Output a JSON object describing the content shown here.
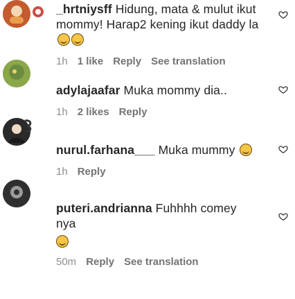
{
  "comments": [
    {
      "username": "_hrtniysff",
      "text": "Hidung, mata & mulut ikut mommy! Harap2 kening ikut daddy la",
      "emoji_count": 2,
      "time": "1h",
      "likes": "1 like",
      "reply": "Reply",
      "translate": "See translation"
    },
    {
      "username": "adylajaafar",
      "text": "Muka mommy dia..",
      "emoji_count": 0,
      "time": "1h",
      "likes": "2 likes",
      "reply": "Reply"
    },
    {
      "username": "nurul.farhana___",
      "text": "Muka mummy",
      "emoji_count": 1,
      "time": "1h",
      "reply": "Reply"
    },
    {
      "username": "puteri.andrianna",
      "text": "Fuhhhh comey nya",
      "emoji_count": 1,
      "time": "50m",
      "reply": "Reply",
      "translate": "See translation"
    }
  ],
  "colors": {
    "text": "#262626",
    "meta": "#8e8e8e",
    "emoji": "#f6c646"
  },
  "icons": [
    "avatar-hrtniysff",
    "avatar-adylajaafar",
    "avatar-nurul",
    "avatar-puteri",
    "like-heart-icon"
  ]
}
